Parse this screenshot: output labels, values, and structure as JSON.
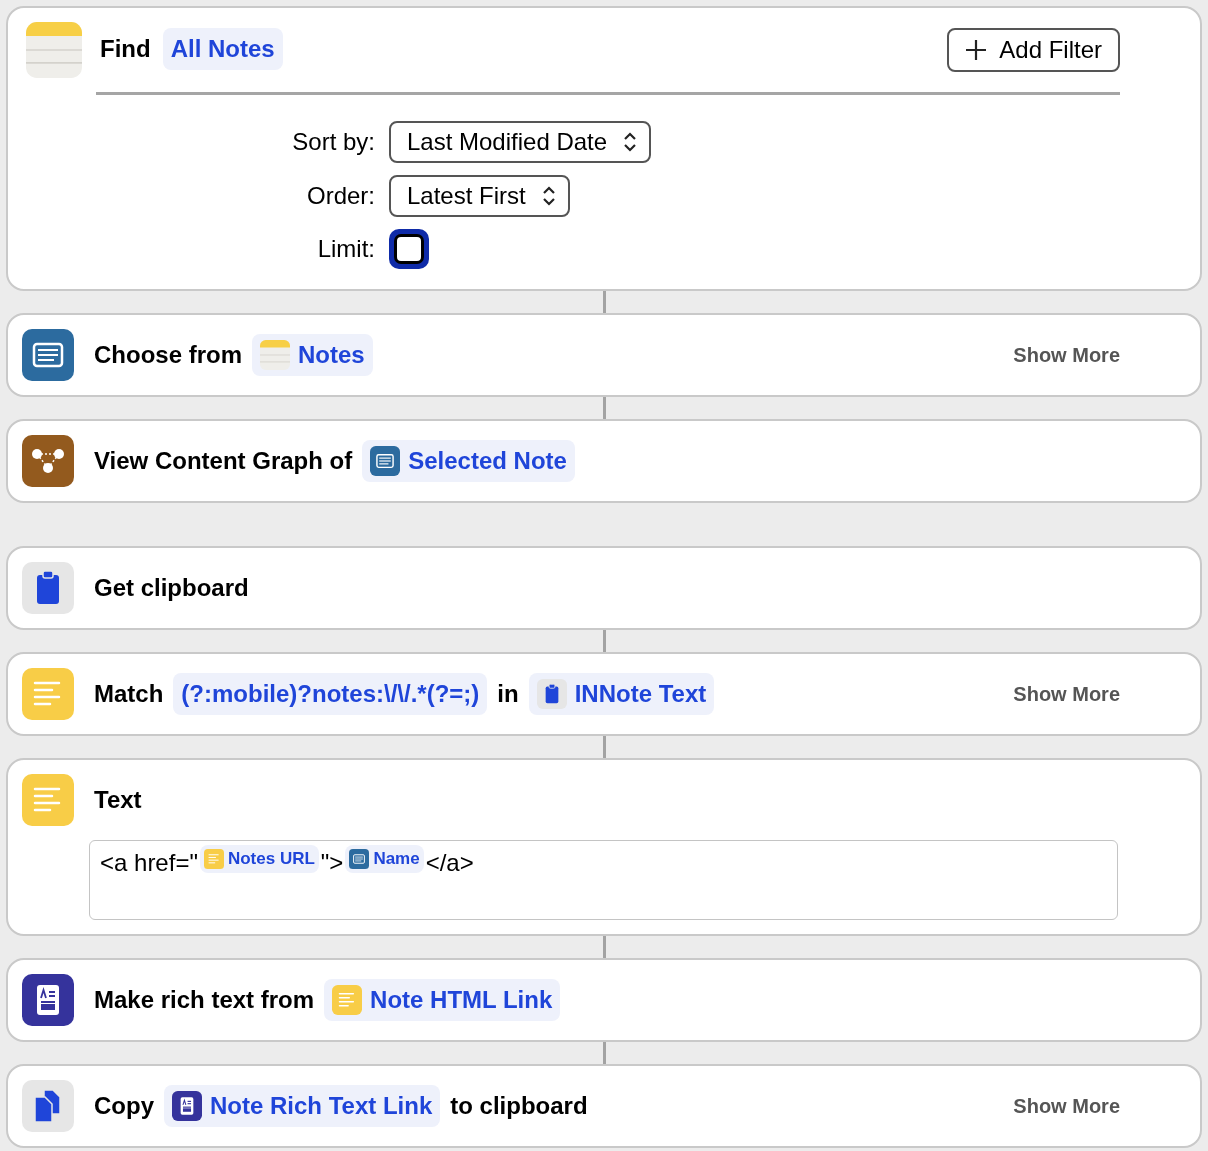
{
  "find": {
    "verb": "Find",
    "token": {
      "text": "All Notes"
    },
    "add_filter": {
      "label": "Add Filter"
    },
    "fields": [
      {
        "kind": "select",
        "label": "Sort by:",
        "value": "Last Modified Date"
      },
      {
        "kind": "select",
        "label": "Order:",
        "value": "Latest First"
      },
      {
        "kind": "checkbox",
        "label": "Limit:",
        "checked": false,
        "focused": true
      }
    ]
  },
  "actions": [
    {
      "connected": true,
      "parts": [
        {
          "kind": "text",
          "text": "Choose from"
        },
        {
          "kind": "token",
          "text": "Notes"
        }
      ],
      "show_more": "Show More"
    },
    {
      "connected": true,
      "parts": [
        {
          "kind": "text",
          "text": "View Content Graph of"
        },
        {
          "kind": "token",
          "text": "Selected Note"
        }
      ]
    },
    {
      "connected": false,
      "parts": [
        {
          "kind": "text",
          "text": "Get clipboard"
        }
      ]
    },
    {
      "connected": true,
      "parts": [
        {
          "kind": "text",
          "text": "Match"
        },
        {
          "kind": "token",
          "text": "(?:mobile)?notes:\\/\\/.*(?=;)"
        },
        {
          "kind": "text",
          "text": "in"
        },
        {
          "kind": "token",
          "text": "INNote Text"
        }
      ],
      "show_more": "Show More"
    },
    {
      "connected": true,
      "parts": [
        {
          "kind": "text",
          "text": "Text"
        }
      ],
      "field": [
        {
          "kind": "text",
          "text": "<a href=\""
        },
        {
          "kind": "token",
          "text": "Notes URL"
        },
        {
          "kind": "text",
          "text": "\">"
        },
        {
          "kind": "token",
          "text": "Name"
        },
        {
          "kind": "text",
          "text": "</a>"
        }
      ]
    },
    {
      "connected": true,
      "parts": [
        {
          "kind": "text",
          "text": "Make rich text from"
        },
        {
          "kind": "token",
          "text": "Note HTML Link"
        }
      ]
    },
    {
      "connected": true,
      "parts": [
        {
          "kind": "text",
          "text": "Copy"
        },
        {
          "kind": "token",
          "text": "Note Rich Text Link"
        },
        {
          "kind": "text",
          "text": "to clipboard"
        }
      ],
      "show_more": "Show More"
    }
  ]
}
